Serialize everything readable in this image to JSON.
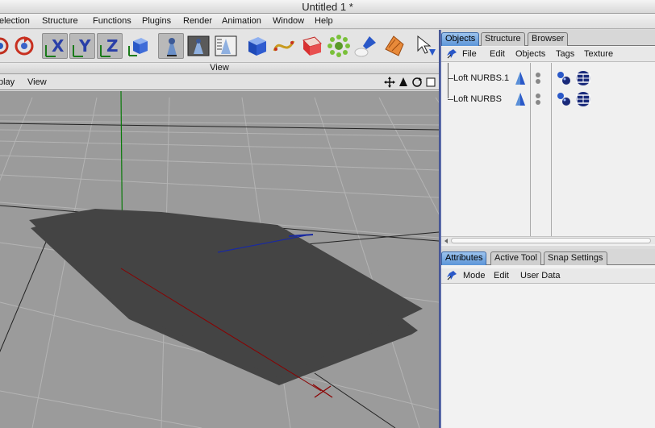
{
  "window": {
    "title": "Untitled 1 *"
  },
  "menubar": {
    "items": [
      "election",
      "Structure",
      "Functions",
      "Plugins",
      "Render",
      "Animation",
      "Window",
      "Help"
    ]
  },
  "toolbar": {
    "tools": [
      "lock-x-icon",
      "lock-y-icon",
      "lock-z-icon",
      "coordinate-system-icon",
      "render-view-icon",
      "render-picture-icon",
      "render-settings-icon",
      "cube-primitive-icon",
      "spline-icon",
      "nurbs-icon",
      "array-icon",
      "light-icon",
      "deformer-icon",
      "scene-cursor-icon"
    ],
    "axis_labels": {
      "x": "X",
      "y": "Y",
      "z": "Z"
    }
  },
  "viewport": {
    "header": "View",
    "menu": [
      "play",
      "View"
    ],
    "nav_icons": [
      "move-view-icon",
      "zoom-view-icon",
      "rotate-view-icon",
      "maximize-view-icon"
    ]
  },
  "objects_panel": {
    "tabs": [
      "Objects",
      "Structure",
      "Browser"
    ],
    "active_tab": "Objects",
    "menu": [
      "File",
      "Edit",
      "Objects",
      "Tags",
      "Texture"
    ],
    "objects": [
      {
        "name": "Loft NURBS.1",
        "icon": "loft-nurbs-icon",
        "tags": [
          "phong-tag-icon",
          "texture-tag-icon"
        ]
      },
      {
        "name": "Loft NURBS",
        "icon": "loft-nurbs-icon",
        "tags": [
          "phong-tag-icon",
          "texture-tag-icon"
        ]
      }
    ]
  },
  "attributes_panel": {
    "tabs": [
      "Attributes",
      "Active Tool",
      "Snap Settings"
    ],
    "active_tab": "Attributes",
    "menu": [
      "Mode",
      "Edit",
      "User Data"
    ]
  },
  "colors": {
    "accent_tab": "#5c95d8",
    "splitter": "#5a6aa8",
    "viewport_bg": "#9b9b9b",
    "mesh": "#444444",
    "axis_x": "#8a0000",
    "axis_y": "#0a7a0a",
    "axis_z": "#1a2aa0"
  }
}
